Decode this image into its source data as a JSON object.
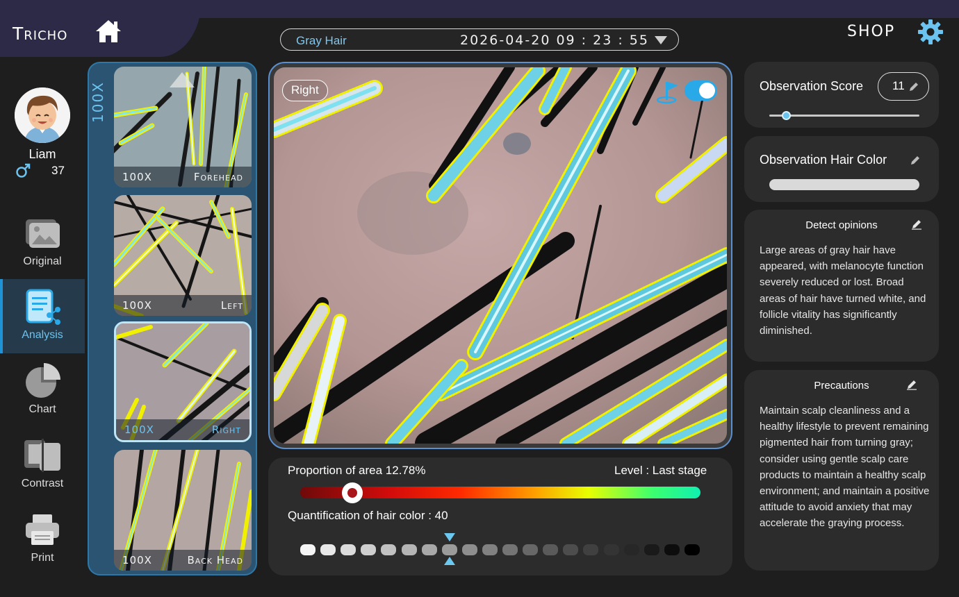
{
  "header": {
    "brand": "Tricho",
    "mode": "Gray Hair",
    "datetime": "2026-04-20 09 : 23 : 55",
    "shop": "SHOP"
  },
  "user": {
    "name": "Liam",
    "age": "37"
  },
  "nav": {
    "items": [
      {
        "label": "Original",
        "icon": "image-icon"
      },
      {
        "label": "Analysis",
        "icon": "report-icon",
        "active": true
      },
      {
        "label": "Chart",
        "icon": "pie-chart-icon"
      },
      {
        "label": "Contrast",
        "icon": "split-compare-icon"
      },
      {
        "label": "Print",
        "icon": "printer-icon"
      }
    ]
  },
  "thumbnails": {
    "magnification_tab": "100X",
    "items": [
      {
        "mag": "100X",
        "area": "Forehead"
      },
      {
        "mag": "100X",
        "area": "Left"
      },
      {
        "mag": "100X",
        "area": "Right",
        "active": true
      },
      {
        "mag": "100X",
        "area": "Back Head"
      }
    ]
  },
  "main_view": {
    "side_label": "Right",
    "overlay_enabled": true
  },
  "stats": {
    "proportion_label": "Proportion of area 12.78%",
    "level_label": "Level : Last stage",
    "proportion_level_fraction": 0.13,
    "quantification_label": "Quantification of hair color : 40",
    "quantification_selected_index": 7,
    "quantification_chip_count": 20
  },
  "observation": {
    "score_label": "Observation Score",
    "score_value": "11",
    "score_fraction": 0.11,
    "hair_color_label": "Observation Hair Color"
  },
  "detect_opinions": {
    "title": "Detect opinions",
    "text": "Large areas of gray hair have appeared, with melanocyte function severely reduced or lost. Broad areas of hair have turned white, and follicle vitality has significantly diminished."
  },
  "precautions": {
    "title": "Precautions",
    "text": "Maintain scalp cleanliness and a healthy lifestyle to prevent remaining pigmented hair from turning gray; consider using gentle scalp care products to maintain a healthy scalp environment; and maintain a positive attitude to avoid anxiety that may accelerate the graying process."
  },
  "colors": {
    "accent": "#1e94d6",
    "accent_light": "#6cc3ef",
    "outline": "#f0f000",
    "brand_bar": "#2d2a48"
  }
}
